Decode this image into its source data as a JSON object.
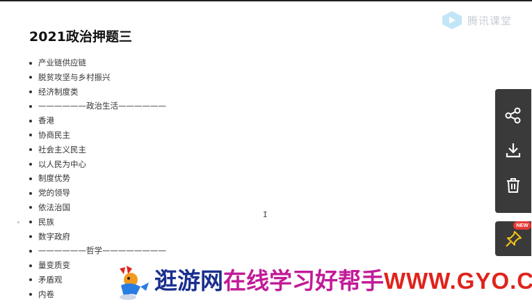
{
  "document": {
    "title": "2021政治押题三",
    "items": [
      "产业链供应链",
      "脱贫攻坚与乡村振兴",
      "经济制度类",
      "——————政治生活——————",
      "香港",
      "协商民主",
      "社会主义民主",
      "以人民为中心",
      "制度优势",
      "党的领导",
      "依法治国",
      "民族",
      "数字政府",
      "——————哲学————————",
      "量变质变",
      "矛盾观",
      "内卷"
    ]
  },
  "watermark": {
    "text": "腾讯课堂",
    "icon": "play-logo-icon"
  },
  "side_actions": {
    "items": [
      {
        "icon": "share-icon"
      },
      {
        "icon": "download-icon"
      },
      {
        "icon": "trash-icon"
      }
    ],
    "pin": {
      "icon": "pin-icon",
      "badge": "NEW"
    }
  },
  "banner": {
    "part1": "逛游网",
    "part2": "在线学习好帮手",
    "part3": "WWW.GYO.CC",
    "colors": {
      "part1": "#1a2f8f",
      "part2": "#c21b98",
      "part3": "#e0231c"
    }
  },
  "colors": {
    "panel": "#3a3a3a",
    "badge": "#e53935"
  }
}
